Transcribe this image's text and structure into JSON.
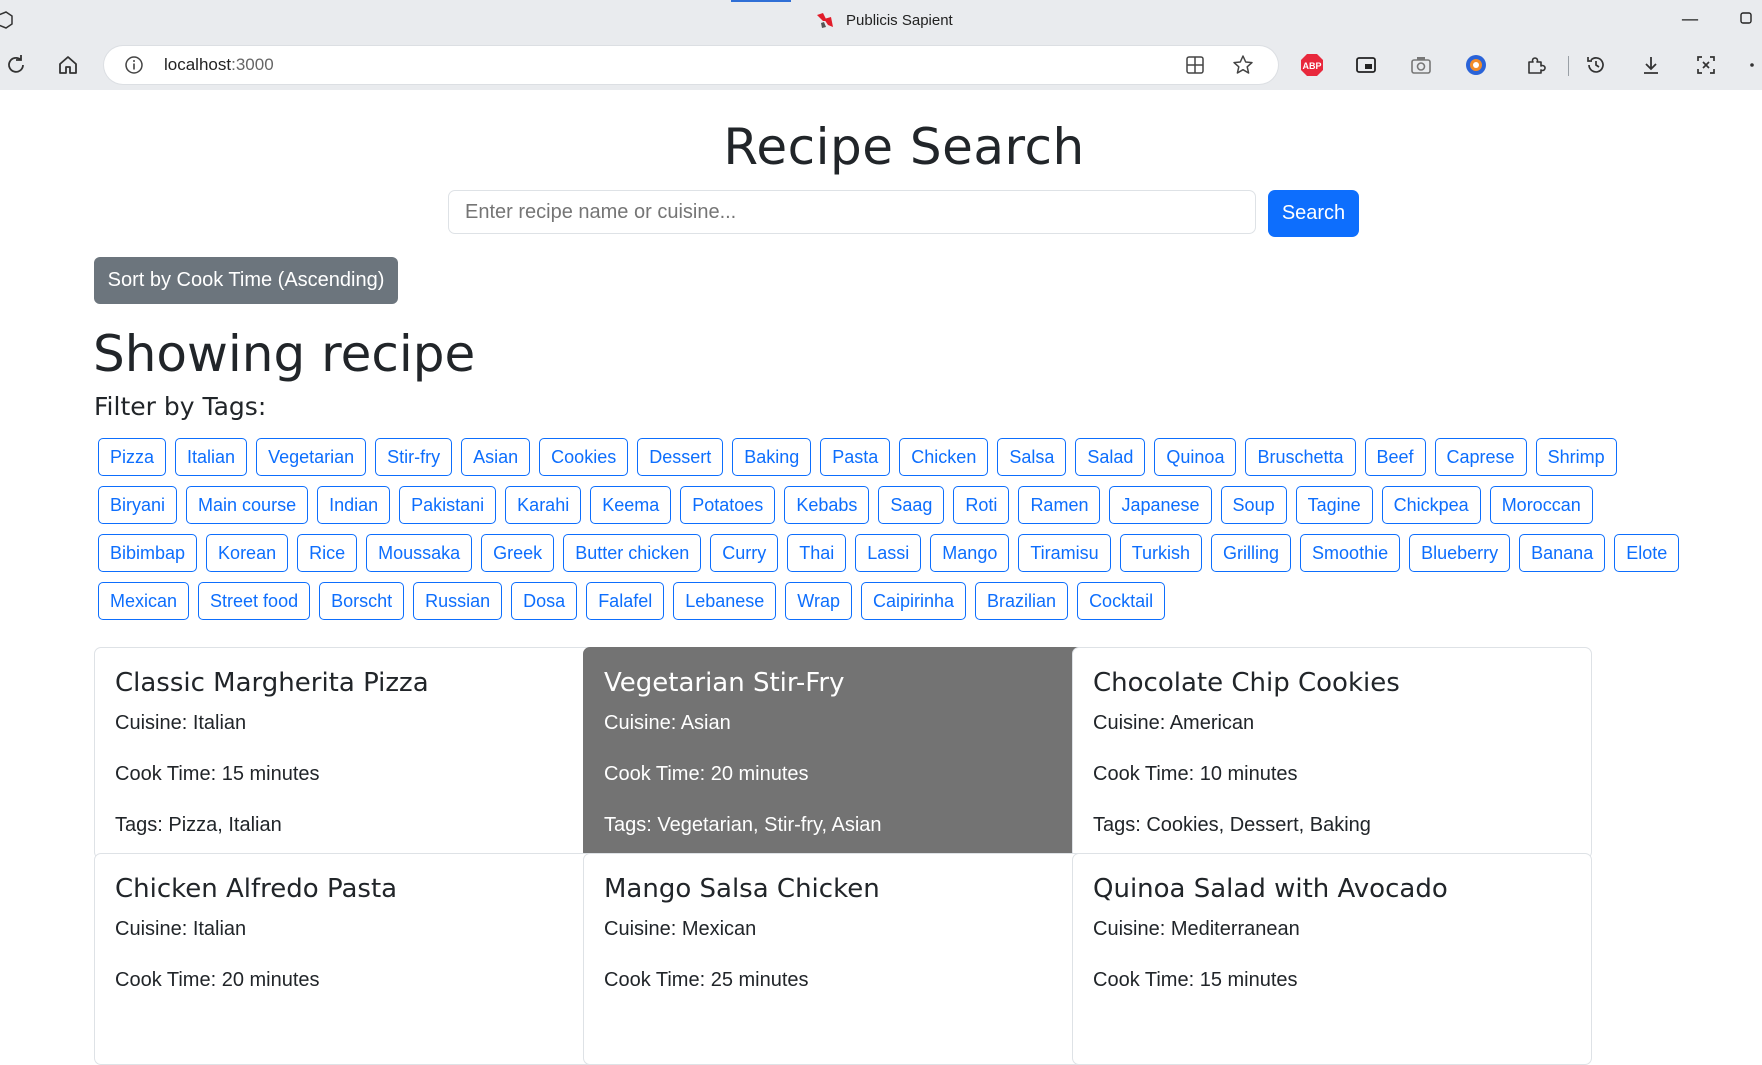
{
  "browser": {
    "tab_title": "Publicis Sapient",
    "url_host": "localhost",
    "url_port": ":3000",
    "icons": [
      "reload-icon",
      "home-icon",
      "info-icon",
      "split-screen-icon",
      "favorite-star-icon",
      "adblock-icon",
      "picture-in-picture-icon",
      "camera-icon",
      "profile-icon",
      "extensions-icon",
      "history-icon",
      "download-icon",
      "screen-capture-icon",
      "more-icon"
    ],
    "adblock_label": "ABP"
  },
  "header": {
    "title": "Recipe Search",
    "search_placeholder": "Enter recipe name or cuisine...",
    "search_button": "Search"
  },
  "sort_button": "Sort by Cook Time (Ascending)",
  "results_heading": "Showing recipe",
  "filter_heading": "Filter by Tags:",
  "tags": [
    "Pizza",
    "Italian",
    "Vegetarian",
    "Stir-fry",
    "Asian",
    "Cookies",
    "Dessert",
    "Baking",
    "Pasta",
    "Chicken",
    "Salsa",
    "Salad",
    "Quinoa",
    "Bruschetta",
    "Beef",
    "Caprese",
    "Shrimp",
    "Biryani",
    "Main course",
    "Indian",
    "Pakistani",
    "Karahi",
    "Keema",
    "Potatoes",
    "Kebabs",
    "Saag",
    "Roti",
    "Ramen",
    "Japanese",
    "Soup",
    "Tagine",
    "Chickpea",
    "Moroccan",
    "Bibimbap",
    "Korean",
    "Rice",
    "Moussaka",
    "Greek",
    "Butter chicken",
    "Curry",
    "Thai",
    "Lassi",
    "Mango",
    "Tiramisu",
    "Turkish",
    "Grilling",
    "Smoothie",
    "Blueberry",
    "Banana",
    "Elote",
    "Mexican",
    "Street food",
    "Borscht",
    "Russian",
    "Dosa",
    "Falafel",
    "Lebanese",
    "Wrap",
    "Caipirinha",
    "Brazilian",
    "Cocktail"
  ],
  "recipes": [
    {
      "name": "Classic Margherita Pizza",
      "cuisine": "Cuisine: Italian",
      "cook_time": "Cook Time: 15 minutes",
      "tags": "Tags: Pizza, Italian"
    },
    {
      "name": "Vegetarian Stir-Fry",
      "cuisine": "Cuisine: Asian",
      "cook_time": "Cook Time: 20 minutes",
      "tags": "Tags: Vegetarian, Stir-fry, Asian"
    },
    {
      "name": "Chocolate Chip Cookies",
      "cuisine": "Cuisine: American",
      "cook_time": "Cook Time: 10 minutes",
      "tags": "Tags: Cookies, Dessert, Baking"
    },
    {
      "name": "Chicken Alfredo Pasta",
      "cuisine": "Cuisine: Italian",
      "cook_time": "Cook Time: 20 minutes",
      "tags": ""
    },
    {
      "name": "Mango Salsa Chicken",
      "cuisine": "Cuisine: Mexican",
      "cook_time": "Cook Time: 25 minutes",
      "tags": ""
    },
    {
      "name": "Quinoa Salad with Avocado",
      "cuisine": "Cuisine: Mediterranean",
      "cook_time": "Cook Time: 15 minutes",
      "tags": ""
    }
  ],
  "highlighted_recipe_index": 1,
  "colors": {
    "primary": "#0d6efd",
    "secondary": "#6c757d",
    "highlight_card": "#737373"
  }
}
